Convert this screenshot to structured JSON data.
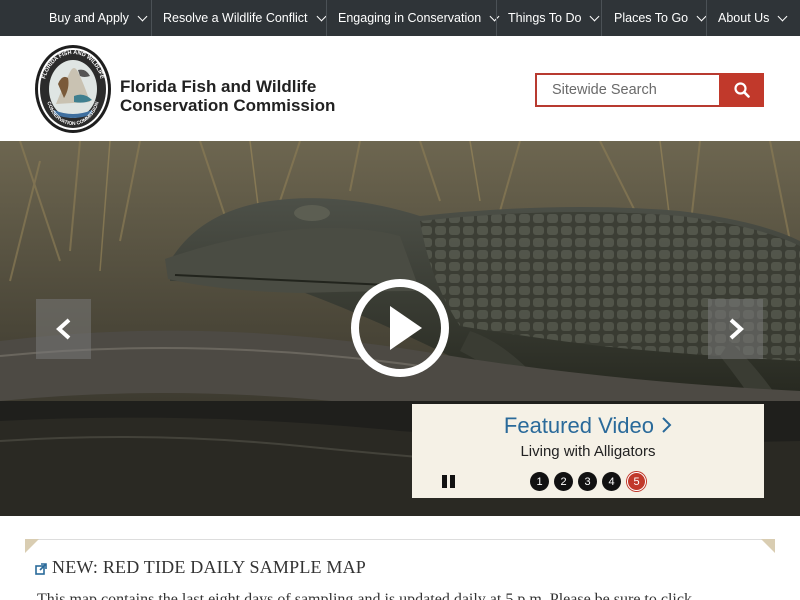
{
  "nav": {
    "items": [
      {
        "label": "Buy and Apply"
      },
      {
        "label": "Resolve a Wildlife Conflict"
      },
      {
        "label": "Engaging in Conservation"
      },
      {
        "label": "Things To Do"
      },
      {
        "label": "Places To Go"
      },
      {
        "label": "About Us"
      }
    ]
  },
  "header": {
    "org_line1": "Florida Fish and Wildlife",
    "org_line2": "Conservation Commission",
    "seal_text_top": "FLORIDA FISH AND WILDLIFE",
    "seal_text_bottom": "CONSERVATION COMMISSION",
    "search_placeholder": "Sitewide Search",
    "search_icon": "search-icon"
  },
  "hero": {
    "feature_title": "Featured Video",
    "feature_subtitle": "Living with Alligators",
    "slides": [
      "1",
      "2",
      "3",
      "4",
      "5"
    ],
    "active_slide": 5,
    "colors": {
      "accent": "#c1392b",
      "link": "#2a6a9a",
      "panel": "#f5f1e6"
    }
  },
  "announcement": {
    "title": "NEW: RED TIDE DAILY SAMPLE MAP",
    "text": "This map contains the last eight days of sampling and is updated daily at 5 p.m. Please be sure to click"
  }
}
